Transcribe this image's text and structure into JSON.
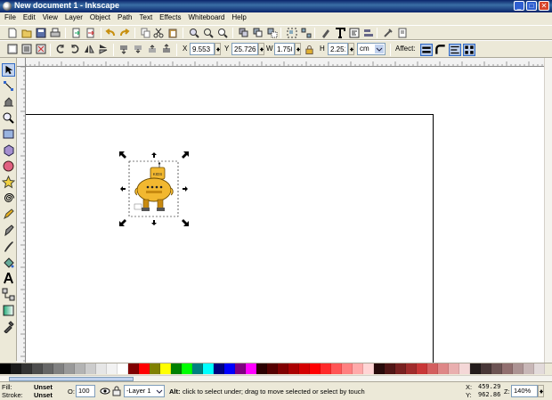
{
  "window": {
    "title": "New document 1 - Inkscape",
    "buttons": [
      "_",
      "□",
      "✕"
    ]
  },
  "menu": [
    "File",
    "Edit",
    "View",
    "Layer",
    "Object",
    "Path",
    "Text",
    "Effects",
    "Whiteboard",
    "Help"
  ],
  "controls": {
    "x_label": "X",
    "x_value": "9.553",
    "y_label": "Y",
    "y_value": "25.726",
    "w_label": "W",
    "w_value": "1.750",
    "h_label": "H",
    "h_value": "2.251",
    "unit": "cm",
    "affect_label": "Affect:"
  },
  "robot_sign": "KIDS",
  "palette": [
    "#000000",
    "#1a1a1a",
    "#333333",
    "#4d4d4d",
    "#666666",
    "#808080",
    "#999999",
    "#b3b3b3",
    "#cccccc",
    "#e6e6e6",
    "#f2f2f2",
    "#ffffff",
    "#800000",
    "#ff0000",
    "#808000",
    "#ffff00",
    "#008000",
    "#00ff00",
    "#008080",
    "#00ffff",
    "#000080",
    "#0000ff",
    "#800080",
    "#ff00ff",
    "#2b0000",
    "#550000",
    "#800000",
    "#aa0000",
    "#d40000",
    "#ff0000",
    "#ff2a2a",
    "#ff5555",
    "#ff8080",
    "#ffaaaa",
    "#ffd5d5",
    "#280b0b",
    "#501616",
    "#782121",
    "#a02c2c",
    "#c83737",
    "#d35f5f",
    "#de8787",
    "#e9afaf",
    "#f4d7d7",
    "#241c1c",
    "#483737",
    "#6c5353",
    "#916f6f",
    "#ac9393",
    "#c8b7b7",
    "#e3dbdb"
  ],
  "status": {
    "fill_label": "Fill:",
    "fill_value": "Unset",
    "stroke_label": "Stroke:",
    "stroke_value": "Unset",
    "opacity_label": "O:",
    "opacity_value": "100",
    "layer": "-Layer 1",
    "message_key": "Alt:",
    "message": "click to select under; drag to move selected or select by touch",
    "x_label": "X:",
    "x_value": "459.29",
    "y_label": "Y:",
    "y_value": "962.86",
    "zoom_label": "Z:",
    "zoom_value": "140%"
  },
  "colors": {
    "title_bar": "#0a246a",
    "chrome": "#ece9d8",
    "robot_body": "#f2b830"
  }
}
